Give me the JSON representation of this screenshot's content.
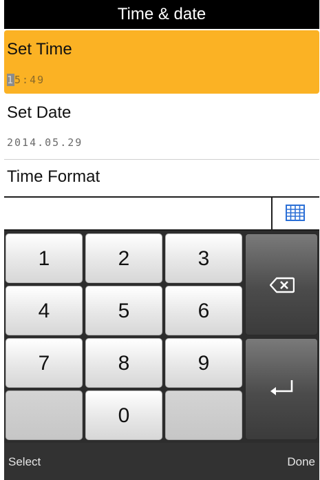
{
  "header": {
    "title": "Time & date"
  },
  "list": {
    "set_time": {
      "title": "Set Time",
      "value_cursor_digit": "1",
      "value_rest": "5:49"
    },
    "set_date": {
      "title": "Set Date",
      "value": "2014.05.29"
    },
    "time_format": {
      "title": "Time Format"
    }
  },
  "keypad": {
    "k1": "1",
    "k2": "2",
    "k3": "3",
    "k4": "4",
    "k5": "5",
    "k6": "6",
    "k7": "7",
    "k8": "8",
    "k9": "9",
    "k0": "0"
  },
  "softkeys": {
    "left": "Select",
    "right": "Done"
  },
  "colors": {
    "selected_highlight": "#fbb224",
    "titlebar": "#000000",
    "keypad_bg": "#2d2d2d",
    "keyboard_icon": "#2b6fd6"
  },
  "icons": {
    "backspace": "backspace-icon",
    "enter": "enter-icon",
    "keyboard": "keyboard-icon"
  }
}
